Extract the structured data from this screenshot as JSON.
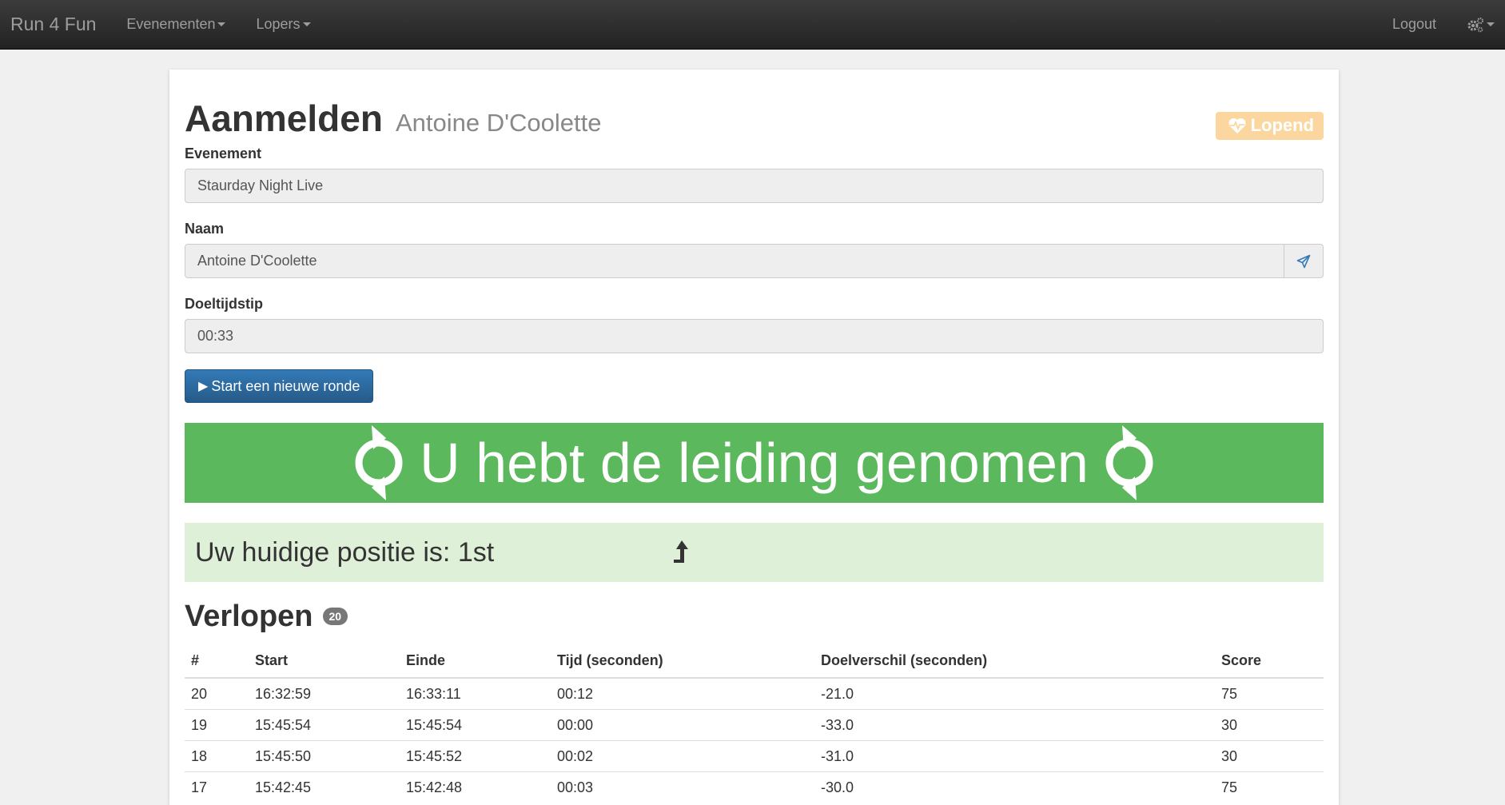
{
  "navbar": {
    "brand": "Run 4 Fun",
    "menu": [
      {
        "label": "Evenementen"
      },
      {
        "label": "Lopers"
      }
    ],
    "logout": "Logout",
    "settings_icon": "gears-icon"
  },
  "page": {
    "title": "Aanmelden",
    "subtitle": "Antoine D'Coolette",
    "status": "Lopend",
    "status_color": "#fbd79f"
  },
  "form": {
    "event_label": "Evenement",
    "event_value": "Staurday Night Live",
    "name_label": "Naam",
    "name_value": "Antoine D'Coolette",
    "target_label": "Doeltijdstip",
    "target_value": "00:33",
    "start_button": "Start een nieuwe ronde"
  },
  "banner": {
    "text": "U hebt de leiding genomen",
    "color": "#5cb85c"
  },
  "position": {
    "text": "Uw huidige positie is: 1st"
  },
  "history": {
    "title": "Verlopen",
    "count": "20",
    "columns": [
      "#",
      "Start",
      "Einde",
      "Tijd (seconden)",
      "Doelverschil (seconden)",
      "Score"
    ],
    "rows": [
      [
        "20",
        "16:32:59",
        "16:33:11",
        "00:12",
        "-21.0",
        "75"
      ],
      [
        "19",
        "15:45:54",
        "15:45:54",
        "00:00",
        "-33.0",
        "30"
      ],
      [
        "18",
        "15:45:50",
        "15:45:52",
        "00:02",
        "-31.0",
        "30"
      ],
      [
        "17",
        "15:42:45",
        "15:42:48",
        "00:03",
        "-30.0",
        "75"
      ]
    ]
  }
}
